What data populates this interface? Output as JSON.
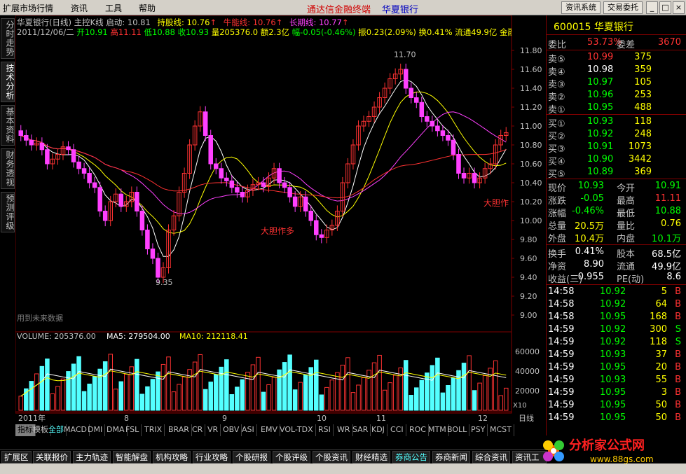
{
  "menubar": {
    "items": [
      "扩展市场行情",
      "资讯",
      "工具",
      "帮助"
    ],
    "app_title": "通达信金融终端",
    "stock_title": "华夏银行",
    "btn_info": "资讯系统",
    "btn_trade": "交易委托"
  },
  "left_tabs": [
    "分时走势",
    "技术分析",
    "基本资料",
    "财务透视",
    "预测评级"
  ],
  "kline": {
    "name": "华夏银行(日线)",
    "indicator": "主控K线",
    "qidong": "启动: 10.81",
    "chigu": "持股线: 10.76",
    "niuneng": "牛能线: 10.76",
    "changqi": "长期线: 10.77",
    "date": "2011/12/06/二",
    "open": "开10.91",
    "high": "高11.11",
    "low": "低10.88",
    "close": "收10.93",
    "vol": "量205376.0",
    "amount": "额2.3亿",
    "change": "幅-0.05(-0.46%)",
    "amp": "振0.23(2.09%)",
    "turnover": "换0.41%",
    "float": "流通49.9亿",
    "extra": "金融",
    "annot_high": "11.70",
    "annot_low": "9.35",
    "annot_dadan1": "大胆作多",
    "annot_dadan2": "大胆作",
    "future_note": "用到未来数据"
  },
  "y_axis": [
    "11.80",
    "11.60",
    "11.40",
    "11.20",
    "11.00",
    "10.80",
    "10.60",
    "10.40",
    "10.20",
    "10.00",
    "9.80",
    "9.60",
    "9.40",
    "9.20",
    "9.00"
  ],
  "volume": {
    "label": "VOLUME: 205376.00",
    "ma5": "MA5: 279504.00",
    "ma10": "MA10: 212118.41",
    "y_axis": [
      "60000",
      "40000",
      "20000"
    ],
    "unit": "X10"
  },
  "x_axis": {
    "labels": [
      "2011年",
      "8",
      "9",
      "10",
      "11",
      "12"
    ],
    "period": "日线"
  },
  "indicator_tabs": [
    "指标",
    "模板",
    "全部",
    "MACD",
    "DMI",
    "DMA",
    "FSL",
    "TRIX",
    "BRAR",
    "CR",
    "VR",
    "OBV",
    "ASI",
    "EMV",
    "VOL-TDX",
    "RSI",
    "WR",
    "SAR",
    "KDJ",
    "CCI",
    "ROC",
    "MTM",
    "BOLL",
    "PSY",
    "MCST"
  ],
  "quote": {
    "code": "600015",
    "name": "华夏银行",
    "weibi_label": "委比",
    "weibi": "53.73%",
    "weicha_label": "委差",
    "weicha": "3670",
    "sell": [
      {
        "label": "卖⑤",
        "price": "10.99",
        "vol": "375"
      },
      {
        "label": "卖④",
        "price": "10.98",
        "vol": "359"
      },
      {
        "label": "卖③",
        "price": "10.97",
        "vol": "105"
      },
      {
        "label": "卖②",
        "price": "10.96",
        "vol": "253"
      },
      {
        "label": "卖①",
        "price": "10.95",
        "vol": "488"
      }
    ],
    "buy": [
      {
        "label": "买①",
        "price": "10.93",
        "vol": "118"
      },
      {
        "label": "买②",
        "price": "10.92",
        "vol": "248"
      },
      {
        "label": "买③",
        "price": "10.91",
        "vol": "1073"
      },
      {
        "label": "买④",
        "price": "10.90",
        "vol": "3442"
      },
      {
        "label": "买⑤",
        "price": "10.89",
        "vol": "369"
      }
    ],
    "stats": [
      {
        "l1": "现价",
        "v1": "10.93",
        "l2": "今开",
        "v2": "10.91"
      },
      {
        "l1": "涨跌",
        "v1": "-0.05",
        "l2": "最高",
        "v2": "11.11"
      },
      {
        "l1": "涨幅",
        "v1": "-0.46%",
        "l2": "最低",
        "v2": "10.88"
      },
      {
        "l1": "总量",
        "v1": "20.5万",
        "l2": "量比",
        "v2": "0.76"
      },
      {
        "l1": "外盘",
        "v1": "10.4万",
        "l2": "内盘",
        "v2": "10.1万"
      }
    ],
    "fund": [
      {
        "l1": "换手",
        "v1": "0.41%",
        "l2": "股本",
        "v2": "68.5亿"
      },
      {
        "l1": "净资",
        "v1": "8.90",
        "l2": "流通",
        "v2": "49.9亿"
      },
      {
        "l1": "收益(三)",
        "v1": "0.955",
        "l2": "PE(动)",
        "v2": "8.6"
      }
    ],
    "ticks": [
      {
        "t": "14:58",
        "p": "10.92",
        "v": "5",
        "d": "B"
      },
      {
        "t": "14:58",
        "p": "10.92",
        "v": "64",
        "d": "B"
      },
      {
        "t": "14:58",
        "p": "10.95",
        "v": "168",
        "d": "B"
      },
      {
        "t": "14:59",
        "p": "10.92",
        "v": "300",
        "d": "S"
      },
      {
        "t": "14:59",
        "p": "10.92",
        "v": "118",
        "d": "S"
      },
      {
        "t": "14:59",
        "p": "10.93",
        "v": "37",
        "d": "B"
      },
      {
        "t": "14:59",
        "p": "10.95",
        "v": "20",
        "d": "B"
      },
      {
        "t": "14:59",
        "p": "10.93",
        "v": "55",
        "d": "B"
      },
      {
        "t": "14:59",
        "p": "10.95",
        "v": "3",
        "d": "B"
      },
      {
        "t": "14:59",
        "p": "10.95",
        "v": "50",
        "d": "B"
      },
      {
        "t": "14:59",
        "p": "10.95",
        "v": "50",
        "d": "B"
      }
    ]
  },
  "bottom_tabs": [
    "扩展区",
    "关联报价",
    "主力轨迹",
    "智能解盘",
    "机构攻略",
    "行业攻略",
    "个股研报",
    "个股评级",
    "个股资讯",
    "财经精选",
    "券商公告",
    "券商新闻",
    "综合资讯",
    "资讯工场"
  ],
  "logo": {
    "text": "分析家公式网",
    "url": "www.88gs.com"
  },
  "colors": {
    "up": "#ff3232",
    "down": "#54ffff",
    "kline_up": "#ff3232",
    "kline_down": "#ff40ff",
    "yellow": "#ffff00",
    "green": "#00ff00"
  }
}
